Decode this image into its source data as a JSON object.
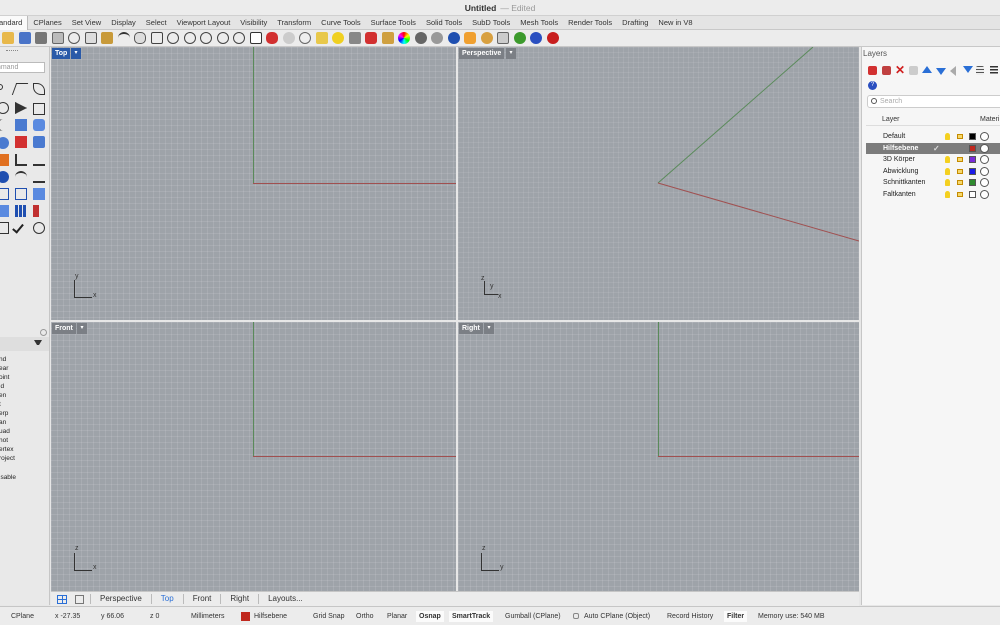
{
  "window": {
    "title": "Untitled",
    "edited": "— Edited"
  },
  "tabs": [
    "andard",
    "CPlanes",
    "Set View",
    "Display",
    "Select",
    "Viewport Layout",
    "Visibility",
    "Transform",
    "Curve Tools",
    "Surface Tools",
    "Solid Tools",
    "SubD Tools",
    "Mesh Tools",
    "Render Tools",
    "Drafting",
    "New in V8"
  ],
  "command": {
    "placeholder": "mmand"
  },
  "osnaps": [
    "nd",
    "ear",
    "oint",
    "id",
    "en",
    "t",
    "erp",
    "an",
    "uad",
    "not",
    "ertex",
    "roject",
    "isable"
  ],
  "viewports": {
    "top": {
      "label": "Top"
    },
    "perspective": {
      "label": "Perspective"
    },
    "front": {
      "label": "Front"
    },
    "right": {
      "label": "Right"
    }
  },
  "viewport_tabs": [
    "Perspective",
    "Top",
    "Front",
    "Right",
    "Layouts..."
  ],
  "layers_panel": {
    "title": "Layers",
    "search_placeholder": "Search",
    "col_layer": "Layer",
    "col_material": "Materi",
    "layers": [
      {
        "name": "Default",
        "color": "#000000"
      },
      {
        "name": "Hilfsebene",
        "color": "#c0281e"
      },
      {
        "name": "3D Körper",
        "color": "#7a2bd8"
      },
      {
        "name": "Abwicklung",
        "color": "#1a1ae8"
      },
      {
        "name": "Schnittkanten",
        "color": "#2e8a2e"
      },
      {
        "name": "Faltkanten",
        "color": "#ffffff"
      }
    ]
  },
  "status": {
    "cplane": "CPlane",
    "x": "x -27.35",
    "y": "y 66.06",
    "z": "z 0",
    "units": "Millimeters",
    "layer": "Hilfsebene",
    "layer_color": "#c0281e",
    "grid_snap": "Grid Snap",
    "ortho": "Ortho",
    "planar": "Planar",
    "osnap": "Osnap",
    "smarttrack": "SmartTrack",
    "gumball": "Gumball (CPlane)",
    "auto_cplane": "Auto CPlane (Object)",
    "record_history": "Record History",
    "filter": "Filter",
    "memory": "Memory use: 540 MB"
  }
}
